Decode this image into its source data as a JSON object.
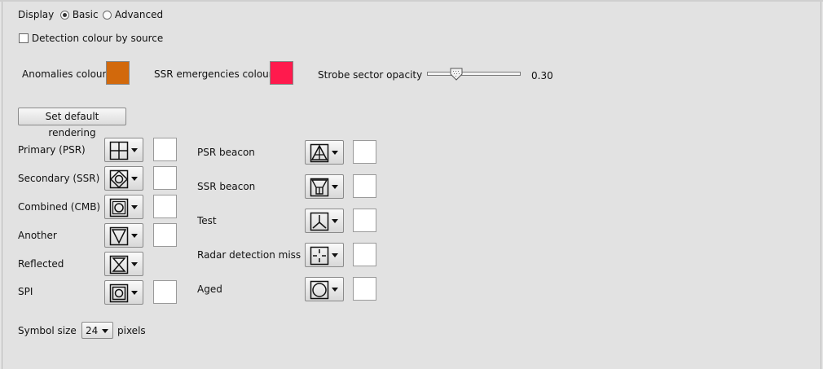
{
  "display": {
    "label": "Display",
    "options": [
      "Basic",
      "Advanced"
    ],
    "selected": "Basic"
  },
  "detection_colour": {
    "label": "Detection colour by source",
    "checked": false
  },
  "colours": {
    "anomalies_label": "Anomalies colour",
    "anomalies_color": "#d2690c",
    "ssr_label": "SSR emergencies colour",
    "ssr_color": "#ff1a4d"
  },
  "strobe": {
    "label": "Strobe sector opacity",
    "value": "0.30"
  },
  "default_button": "Set default rendering",
  "left_symbols": [
    {
      "label": "Primary (PSR)",
      "icon": "cross-square-icon",
      "has_color": true
    },
    {
      "label": "Secondary (SSR)",
      "icon": "diamond-square-icon",
      "has_color": true
    },
    {
      "label": "Combined (CMB)",
      "icon": "circle-square-icon",
      "has_color": true
    },
    {
      "label": "Another",
      "icon": "triangle-down-icon",
      "has_color": true
    },
    {
      "label": "Reflected",
      "icon": "hourglass-icon",
      "has_color": false
    },
    {
      "label": "SPI",
      "icon": "double-square-circle-icon",
      "has_color": true
    }
  ],
  "right_symbols": [
    {
      "label": "PSR beacon",
      "icon": "triangle-beacon-icon",
      "has_color": true
    },
    {
      "label": "SSR beacon",
      "icon": "ssr-beacon-icon",
      "has_color": true
    },
    {
      "label": "Test",
      "icon": "test-y-icon",
      "has_color": true
    },
    {
      "label": "Radar detection miss",
      "icon": "detection-miss-icon",
      "has_color": true
    },
    {
      "label": "Aged",
      "icon": "circle-icon",
      "has_color": true
    }
  ],
  "symbol_size": {
    "label": "Symbol size",
    "value": "24",
    "unit": "pixels"
  }
}
